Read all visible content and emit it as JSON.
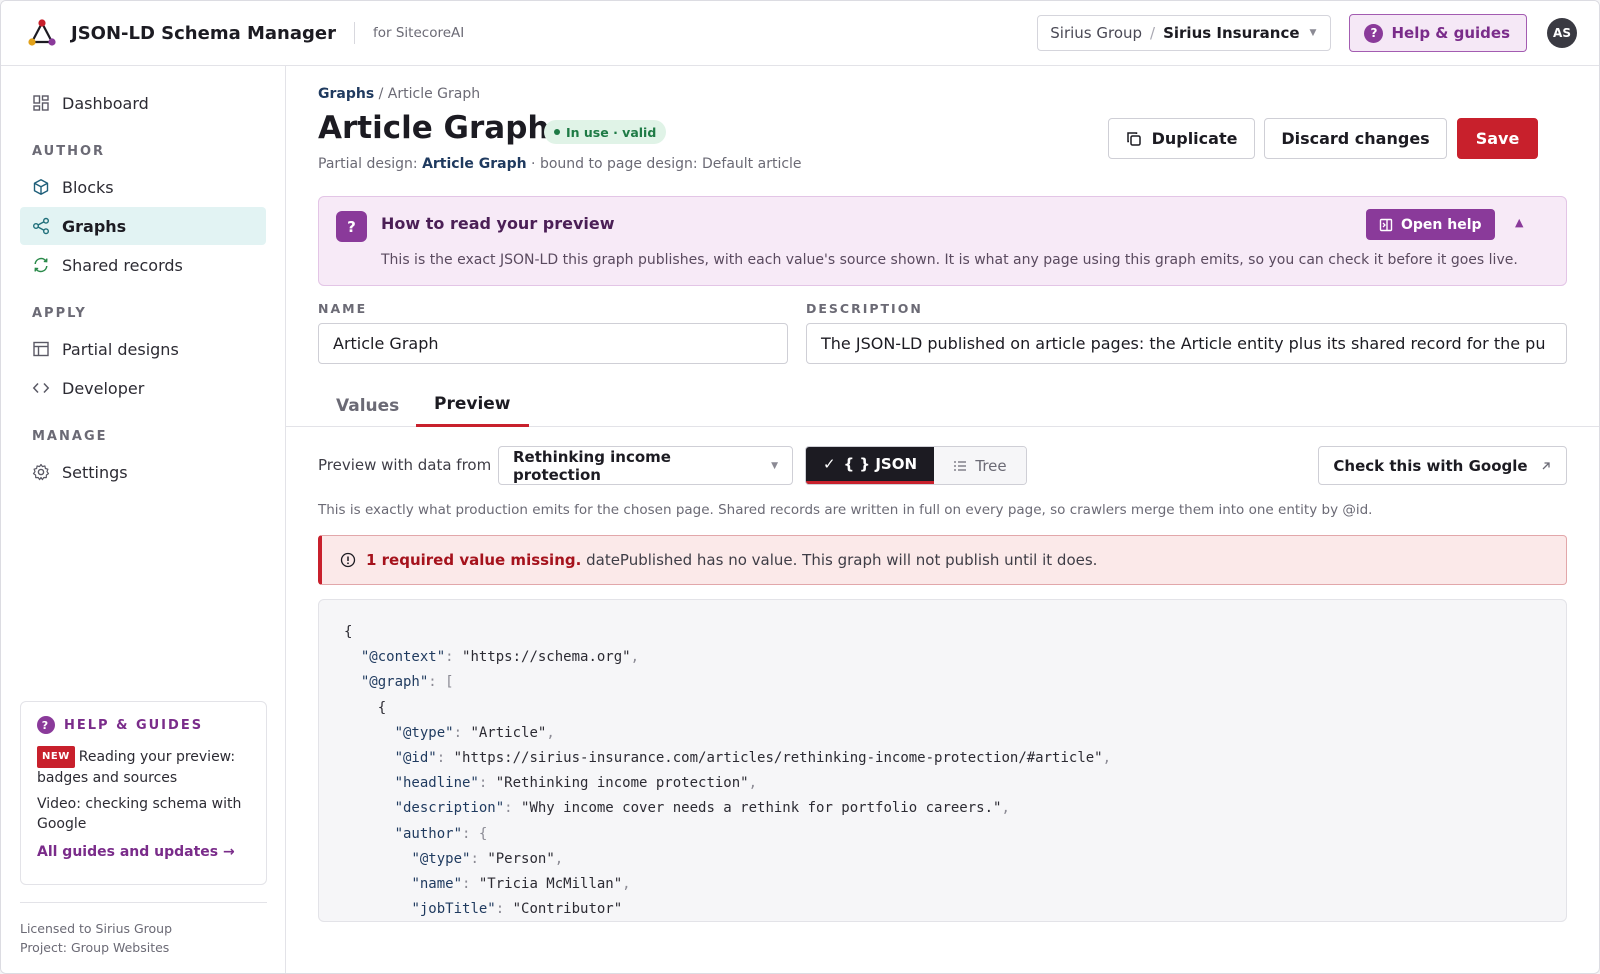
{
  "app": {
    "title": "JSON-LD Schema Manager",
    "for_label": "for SitecoreAI"
  },
  "header": {
    "site_group": "Sirius Group",
    "site_separator": "/",
    "site_name": "Sirius Insurance",
    "help_label": "Help & guides",
    "avatar_initials": "AS"
  },
  "sidebar": {
    "dashboard": "Dashboard",
    "sections": {
      "author": "AUTHOR",
      "apply": "APPLY",
      "manage": "MANAGE"
    },
    "items": {
      "blocks": "Blocks",
      "graphs": "Graphs",
      "shared_records": "Shared records",
      "partial_designs": "Partial designs",
      "developer": "Developer",
      "settings": "Settings"
    },
    "guides": {
      "title": "HELP & GUIDES",
      "new_badge": "NEW",
      "guide1": "Reading your preview: badges and sources",
      "guide2": "Video: checking schema with Google",
      "link": "All guides and updates →"
    },
    "footer": {
      "license": "Licensed to Sirius Group",
      "project": "Project: Group Websites"
    }
  },
  "page": {
    "breadcrumb_root": "Graphs",
    "breadcrumb_sep": " / ",
    "breadcrumb_current": "Article Graph",
    "title": "Article Graph",
    "status": "In use · valid",
    "sub_prefix": "Partial design: ",
    "sub_link": "Article Graph",
    "sub_suffix": " · bound to page design: Default article",
    "actions": {
      "duplicate": "Duplicate",
      "discard": "Discard changes",
      "save": "Save"
    }
  },
  "help_banner": {
    "icon": "?",
    "title": "How to read your preview",
    "body": "This is the exact JSON-LD this graph publishes, with each value's source shown. It is what any page using this graph emits, so you can check it before it goes live.",
    "open_help": "Open help"
  },
  "form": {
    "name_label": "NAME",
    "name_value": "Article Graph",
    "description_label": "DESCRIPTION",
    "description_value": "The JSON-LD published on article pages: the Article entity plus its shared record for the pu"
  },
  "tabs": {
    "values": "Values",
    "preview": "Preview"
  },
  "preview": {
    "data_label": "Preview with data from",
    "selected_page": "Rethinking income protection",
    "json_label": "{ } JSON",
    "tree_label": "Tree",
    "google_label": "Check this with Google",
    "note": "This is exactly what production emits for the chosen page. Shared records are written in full on every page, so crawlers merge them into one entity by @id.",
    "error_strong": "1 required value missing.",
    "error_text": "datePublished has no value. This graph will not publish until it does."
  },
  "json_lines": [
    "{",
    "  \"@context\": \"https://schema.org\",",
    "  \"@graph\": [",
    "    {",
    "      \"@type\": \"Article\",",
    "      \"@id\": \"https://sirius-insurance.com/articles/rethinking-income-protection/#article\",",
    "      \"headline\": \"Rethinking income protection\",",
    "      \"description\": \"Why income cover needs a rethink for portfolio careers.\",",
    "      \"author\": {",
    "        \"@type\": \"Person\",",
    "        \"name\": \"Tricia McMillan\",",
    "        \"jobTitle\": \"Contributor\"",
    "      },"
  ],
  "colors": {
    "accent": "#c8202c",
    "help": "#8a3a9a",
    "nav_active": "#e2f3f3",
    "valid": "#1e7a45"
  }
}
